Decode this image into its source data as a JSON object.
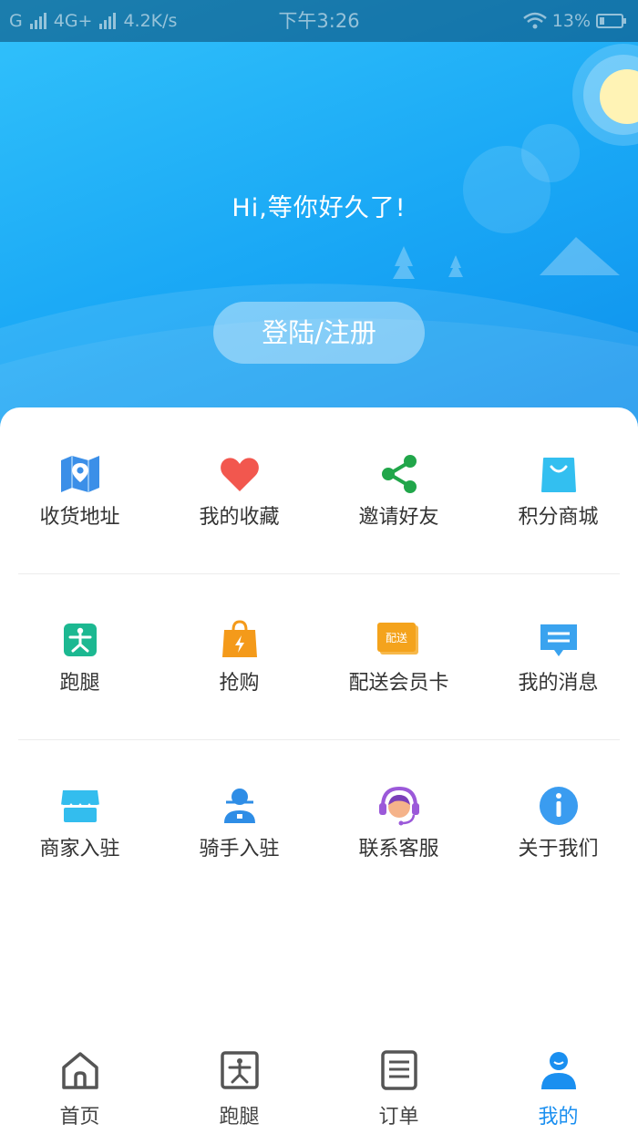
{
  "statusbar": {
    "carrier1": "G",
    "network": "4G+",
    "speed": "4.2K/s",
    "time": "下午3:26",
    "battery": "13%"
  },
  "hero": {
    "greeting": "Hi,等你好久了!",
    "login_label": "登陆/注册"
  },
  "menu": {
    "rows": [
      [
        {
          "label": "收货地址",
          "icon": "map-pin-icon",
          "color": "#3b8fe8"
        },
        {
          "label": "我的收藏",
          "icon": "heart-icon",
          "color": "#f2574e"
        },
        {
          "label": "邀请好友",
          "icon": "share-icon",
          "color": "#21a64a"
        },
        {
          "label": "积分商城",
          "icon": "shopping-bag-icon",
          "color": "#33bff0"
        }
      ],
      [
        {
          "label": "跑腿",
          "icon": "runner-icon",
          "color": "#1cb891"
        },
        {
          "label": "抢购",
          "icon": "flash-bag-icon",
          "color": "#f49a1a"
        },
        {
          "label": "配送会员卡",
          "icon": "delivery-card-icon",
          "color": "#f4a31c",
          "badge": "配送"
        },
        {
          "label": "我的消息",
          "icon": "message-icon",
          "color": "#3aa3ef"
        }
      ],
      [
        {
          "label": "商家入驻",
          "icon": "store-icon",
          "color": "#33bdee"
        },
        {
          "label": "骑手入驻",
          "icon": "rider-icon",
          "color": "#3597e8"
        },
        {
          "label": "联系客服",
          "icon": "customer-service-icon",
          "color": "#9b59d9"
        },
        {
          "label": "关于我们",
          "icon": "info-icon",
          "color": "#3a9cf0"
        }
      ]
    ]
  },
  "tabbar": {
    "tabs": [
      {
        "label": "首页",
        "icon": "home-icon",
        "active": false
      },
      {
        "label": "跑腿",
        "icon": "errand-icon",
        "active": false
      },
      {
        "label": "订单",
        "icon": "order-icon",
        "active": false
      },
      {
        "label": "我的",
        "icon": "profile-icon",
        "active": true
      }
    ],
    "active_color": "#1a8ff0",
    "inactive_color": "#555555"
  }
}
